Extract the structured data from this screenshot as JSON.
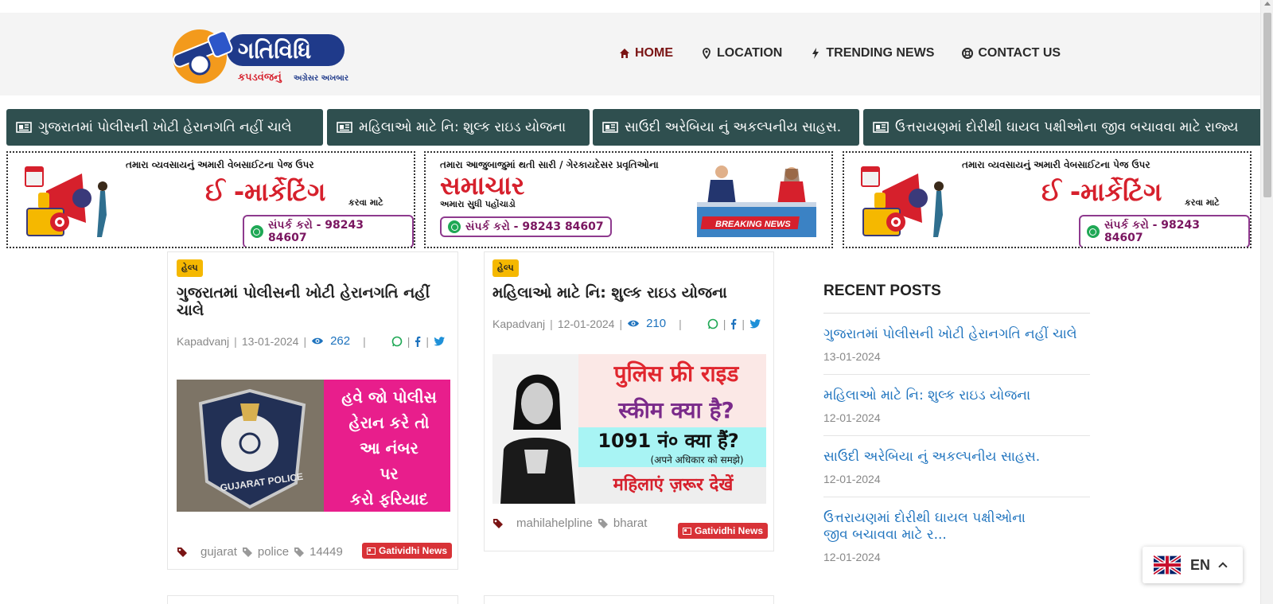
{
  "logo": {
    "title": "ગતિવિધિ",
    "tagline_a": "કપડવંજનું",
    "tagline_b": "અગ્રેસર અખબાર"
  },
  "nav": [
    {
      "label": "HOME",
      "icon": "home-icon"
    },
    {
      "label": "LOCATION",
      "icon": "map-pin-icon"
    },
    {
      "label": "TRENDING NEWS",
      "icon": "bolt-icon"
    },
    {
      "label": "CONTACT US",
      "icon": "life-ring-icon"
    }
  ],
  "ticker": [
    "ગુજરાતમાં પોલીસની ખોટી હેરાનગતિ નહીં ચાલે",
    "મહિલાઓ માટે નિ: શુલ્ક રાઇડ યોજના",
    "સાઉદી અરેબિયા નું અકલ્પનીય સાહસ.",
    "ઉત્તરાયણમાં દોરીથી ઘાયલ પક્ષીઓના જીવ બચાવવા માટે રાજ્ય"
  ],
  "ads": {
    "emarketing": {
      "line1": "તમારા વ્યવસાયનું અમારી વેબસાઈટના પેજ ઉપર",
      "big": "ઈ -માર્કેટિંગ",
      "small": "કરવા માટે",
      "contact": "સંપર્ક કરો - 98243 84607"
    },
    "news": {
      "line1": "તમારા આજુબાજુમાં થતી સારી / ગેરકાયદેસર પ્રવૃતિઓના",
      "big": "સમાચાર",
      "small": "અમારા સુધી પહોંચાડો",
      "contact": "સંપર્ક કરો - 98243 84607",
      "breaking": "BREAKING NEWS"
    }
  },
  "cards": [
    {
      "category": "હેલ્પ",
      "title": "ગુજરાતમાં પોલીસની ખોટી હેરાનગતિ નહીં ચાલે",
      "location": "Kapadvanj",
      "date": "13-01-2024",
      "views": "262",
      "image_lines": [
        "હવે જો પોલીસ",
        "હેરાન કરે તો",
        "આ નંબર",
        "પર",
        "કરો ફરિયાદ"
      ],
      "image_badge_text": "GUJARAT POLICE",
      "tags": [
        "gujarat",
        "police",
        "14449"
      ],
      "source": "Gatividhi News"
    },
    {
      "category": "હેલ્પ",
      "title": "મહિલાઓ માટે નિ: શુલ્ક રાઇડ યોજના",
      "location": "Kapadvanj",
      "date": "12-01-2024",
      "views": "210",
      "image_lines": [
        "पुलिस फ्री राइड",
        "स्कीम क्या है?",
        "1091 नं० क्या हैं?",
        "(अपने अधिकार को समझे)",
        "महिलाएं ज़रूर देखें"
      ],
      "tags": [
        "mahilahelpline",
        "bharat"
      ],
      "source": "Gatividhi News"
    }
  ],
  "sidebar": {
    "title": "RECENT POSTS",
    "posts": [
      {
        "title": "ગુજરાતમાં પોલીસની ખોટી હેરાનગતિ નહીં ચાલે",
        "date": "13-01-2024"
      },
      {
        "title": "મહિલાઓ માટે નિ: શુલ્ક રાઇડ યોજના",
        "date": "12-01-2024"
      },
      {
        "title": "સાઉદી અરેબિયા નું અકલ્પનીય સાહસ.",
        "date": "12-01-2024"
      },
      {
        "title": "ઉત્તરાયણમાં દોરીથી ઘાયલ પક્ષીઓના જીવ બચાવવા માટે ર...",
        "date": "12-01-2024"
      }
    ]
  },
  "language": {
    "label": "EN",
    "flag": "uk-flag-icon"
  },
  "colors": {
    "ticker_bg": "#2f4f4f",
    "link": "#1e73be",
    "category_badge": "#f5b800",
    "source_badge": "#d83237",
    "nav_active": "#7a1414"
  }
}
